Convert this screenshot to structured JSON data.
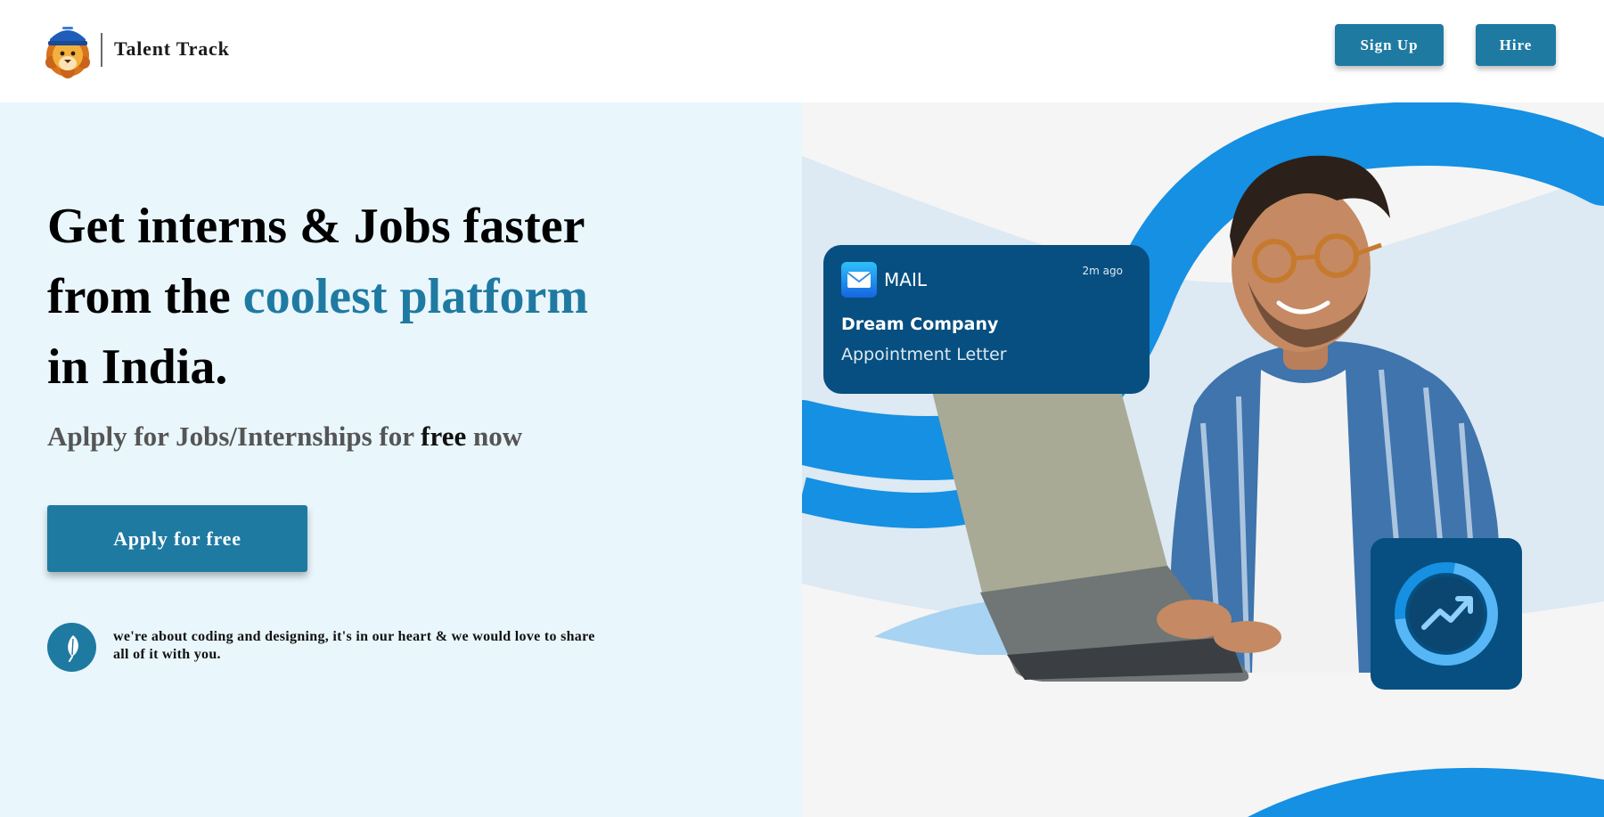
{
  "header": {
    "brand": "Talent Track",
    "signup_label": "Sign Up",
    "hire_label": "Hire"
  },
  "hero": {
    "headline_line1": "Get interns & Jobs faster",
    "headline_line2_prefix": "from the ",
    "headline_line2_accent": "coolest platform",
    "headline_line3": "in India.",
    "sub_prefix": "Aplply for Jobs/Internships for ",
    "sub_emphasis": "free",
    "sub_suffix": " now",
    "apply_label": "Apply for free",
    "tagline": "we're about coding and designing, it's in our heart & we would love to share all of it with you."
  },
  "notification": {
    "app": "MAIL",
    "time": "2m ago",
    "sender": "Dream Company",
    "subject": "Appointment Letter"
  },
  "colors": {
    "accent": "#1f7aa2",
    "hero_left_bg": "#e9f6fc",
    "card_bg": "#064f80",
    "wave_blue": "#1590e3"
  },
  "icons": {
    "logo": "lion-mascot-logo",
    "feather": "feather-icon",
    "mail": "envelope-icon",
    "progress": "trend-up-icon"
  }
}
